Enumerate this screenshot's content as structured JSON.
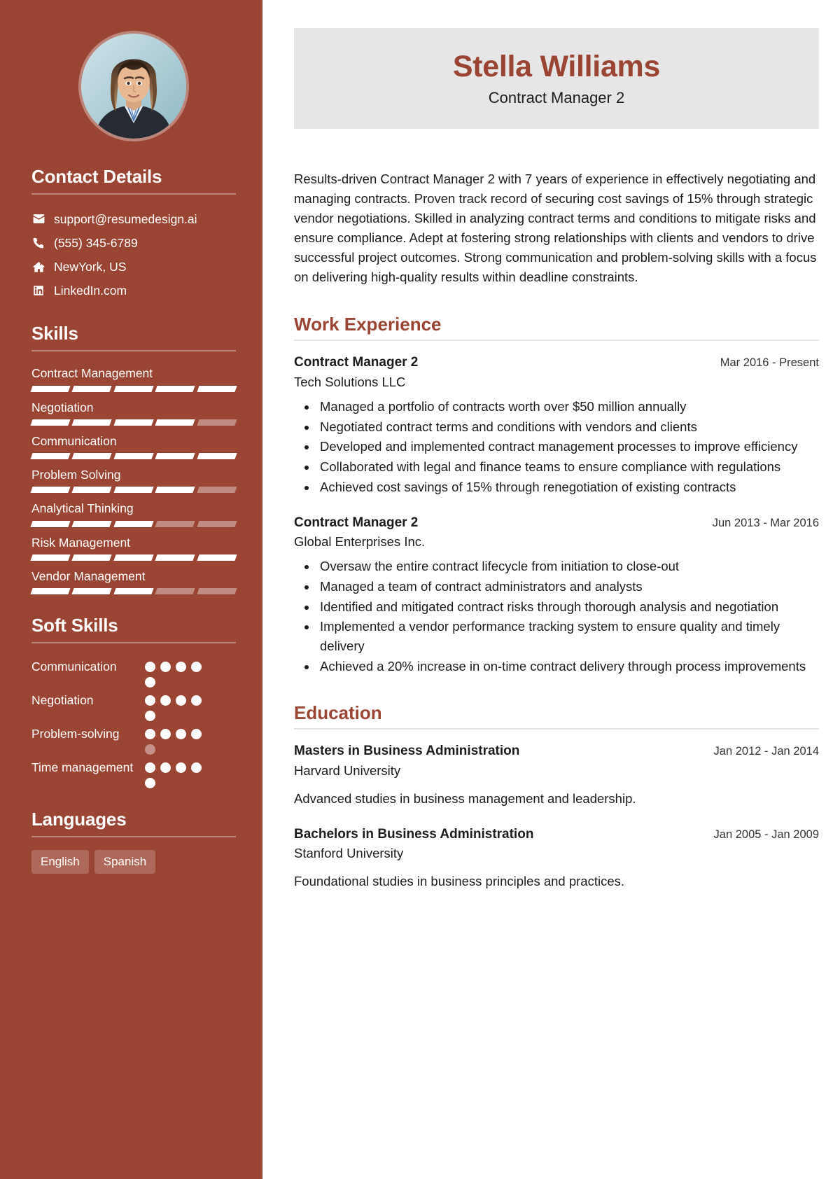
{
  "theme": {
    "sidebar_bg": "#9a4433",
    "accent": "#9a4433",
    "name_card_bg": "#e6e6e6",
    "sidebar_text": "#ffffff"
  },
  "header": {
    "name": "Stella Williams",
    "job_title": "Contract Manager 2"
  },
  "summary": "Results-driven Contract Manager 2 with 7 years of experience in effectively negotiating and managing contracts. Proven track record of securing cost savings of 15% through strategic vendor negotiations. Skilled in analyzing contract terms and conditions to mitigate risks and ensure compliance. Adept at fostering strong relationships with clients and vendors to drive successful project outcomes. Strong communication and problem-solving skills with a focus on delivering high-quality results within deadline constraints.",
  "sidebar": {
    "avatar_alt": "profile-photo",
    "contact": {
      "title": "Contact Details",
      "items": [
        {
          "icon": "envelope-icon",
          "value": "support@resumedesign.ai"
        },
        {
          "icon": "phone-icon",
          "value": "(555) 345-6789"
        },
        {
          "icon": "home-icon",
          "value": "NewYork, US"
        },
        {
          "icon": "linkedin-icon",
          "value": "LinkedIn.com"
        }
      ]
    },
    "skills": {
      "title": "Skills",
      "segments_total": 5,
      "items": [
        {
          "label": "Contract Management",
          "filled": 5
        },
        {
          "label": "Negotiation",
          "filled": 4
        },
        {
          "label": "Communication",
          "filled": 5
        },
        {
          "label": "Problem Solving",
          "filled": 4
        },
        {
          "label": "Analytical Thinking",
          "filled": 3
        },
        {
          "label": "Risk Management",
          "filled": 5
        },
        {
          "label": "Vendor Management",
          "filled": 3
        }
      ]
    },
    "soft_skills": {
      "title": "Soft Skills",
      "dots_total": 5,
      "items": [
        {
          "label": "Communication",
          "filled": 5
        },
        {
          "label": "Negotiation",
          "filled": 5
        },
        {
          "label": "Problem-solving",
          "filled": 4
        },
        {
          "label": "Time management",
          "filled": 5
        }
      ]
    },
    "languages": {
      "title": "Languages",
      "items": [
        "English",
        "Spanish"
      ]
    }
  },
  "work_experience": {
    "title": "Work Experience",
    "entries": [
      {
        "role": "Contract Manager 2",
        "date": "Mar 2016 - Present",
        "org": "Tech Solutions LLC",
        "bullets": [
          "Managed a portfolio of contracts worth over $50 million annually",
          "Negotiated contract terms and conditions with vendors and clients",
          "Developed and implemented contract management processes to improve efficiency",
          "Collaborated with legal and finance teams to ensure compliance with regulations",
          "Achieved cost savings of 15% through renegotiation of existing contracts"
        ]
      },
      {
        "role": "Contract Manager 2",
        "date": "Jun 2013 - Mar 2016",
        "org": "Global Enterprises Inc.",
        "bullets": [
          "Oversaw the entire contract lifecycle from initiation to close-out",
          "Managed a team of contract administrators and analysts",
          "Identified and mitigated contract risks through thorough analysis and negotiation",
          "Implemented a vendor performance tracking system to ensure quality and timely delivery",
          "Achieved a 20% increase in on-time contract delivery through process improvements"
        ]
      }
    ]
  },
  "education": {
    "title": "Education",
    "entries": [
      {
        "degree": "Masters in Business Administration",
        "date": "Jan 2012 - Jan 2014",
        "school": "Harvard University",
        "description": "Advanced studies in business management and leadership."
      },
      {
        "degree": "Bachelors in Business Administration",
        "date": "Jan 2005 - Jan 2009",
        "school": "Stanford University",
        "description": "Foundational studies in business principles and practices."
      }
    ]
  }
}
